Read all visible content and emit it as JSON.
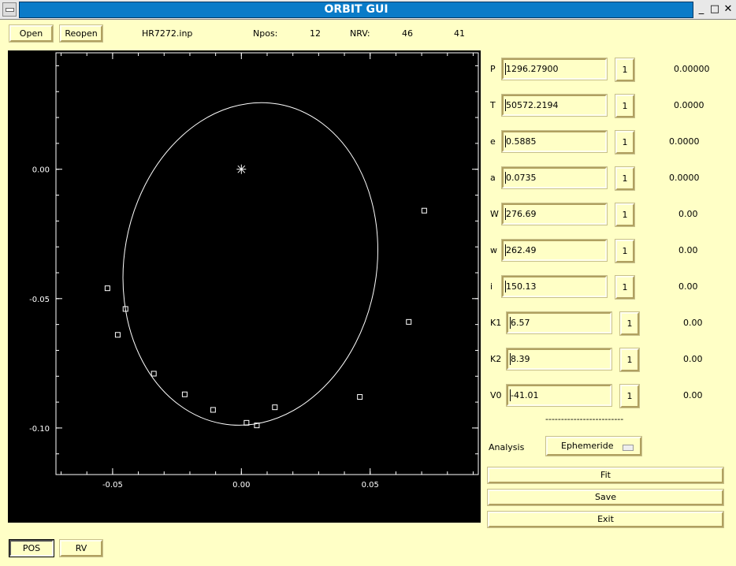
{
  "window": {
    "title": "ORBIT GUI",
    "controls": [
      "_",
      "□",
      "✕"
    ]
  },
  "toolbar": {
    "open_label": "Open",
    "reopen_label": "Reopen",
    "filename": "HR7272.inp",
    "npos_label": "Npos:",
    "npos_value": "12",
    "nrv_label": "NRV:",
    "nrv_value1": "46",
    "nrv_value2": "41"
  },
  "plot": {
    "x_ticks": [
      "-0.05",
      "0.00",
      "0.05"
    ],
    "y_ticks": [
      "0.00",
      "-0.05",
      "-0.10"
    ]
  },
  "chart_data": {
    "type": "scatter",
    "xlim": [
      -0.072,
      0.092
    ],
    "ylim": [
      -0.118,
      0.045
    ],
    "x_ticks": [
      -0.05,
      0.0,
      0.05
    ],
    "y_ticks": [
      0.0,
      -0.05,
      -0.1
    ],
    "primary_star": [
      0.0,
      0.0
    ],
    "orbit_ellipse": {
      "center": [
        0.0035,
        -0.0366
      ],
      "rx": 0.049,
      "ry": 0.0627,
      "rotation_deg": 10
    },
    "observations": [
      [
        -0.052,
        -0.046
      ],
      [
        -0.045,
        -0.054
      ],
      [
        -0.048,
        -0.064
      ],
      [
        -0.034,
        -0.079
      ],
      [
        -0.022,
        -0.087
      ],
      [
        -0.011,
        -0.093
      ],
      [
        0.002,
        -0.098
      ],
      [
        0.006,
        -0.099
      ],
      [
        0.013,
        -0.092
      ],
      [
        0.046,
        -0.088
      ],
      [
        0.065,
        -0.059
      ],
      [
        0.071,
        -0.016
      ]
    ],
    "grid": false
  },
  "params": [
    {
      "name": "P",
      "value": "1296.27900",
      "flag": "1",
      "error": "0.00000"
    },
    {
      "name": "T",
      "value": "50572.2194",
      "flag": "1",
      "error": "0.0000"
    },
    {
      "name": "e",
      "value": "0.5885",
      "flag": "1",
      "error": "0.0000"
    },
    {
      "name": "a",
      "value": "0.0735",
      "flag": "1",
      "error": "0.0000"
    },
    {
      "name": "W",
      "value": "276.69",
      "flag": "1",
      "error": "0.00"
    },
    {
      "name": "w",
      "value": "262.49",
      "flag": "1",
      "error": "0.00"
    },
    {
      "name": "i",
      "value": "150.13",
      "flag": "1",
      "error": "0.00"
    },
    {
      "name": "K1",
      "value": "6.57",
      "flag": "1",
      "error": "0.00"
    },
    {
      "name": "K2",
      "value": "8.39",
      "flag": "1",
      "error": "0.00"
    },
    {
      "name": "V0",
      "value": "-41.01",
      "flag": "1",
      "error": "0.00"
    }
  ],
  "separator": "-------------------------",
  "analysis": {
    "label": "Analysis",
    "selected": "Ephemeride"
  },
  "actions": {
    "fit_label": "Fit",
    "save_label": "Save",
    "exit_label": "Exit"
  },
  "view_buttons": {
    "pos_label": "POS",
    "rv_label": "RV"
  },
  "colors": {
    "background": "#ffffc6",
    "titlebar": "#0a7bc8",
    "plot_bg": "#000000",
    "plot_fg": "#ffffff"
  }
}
